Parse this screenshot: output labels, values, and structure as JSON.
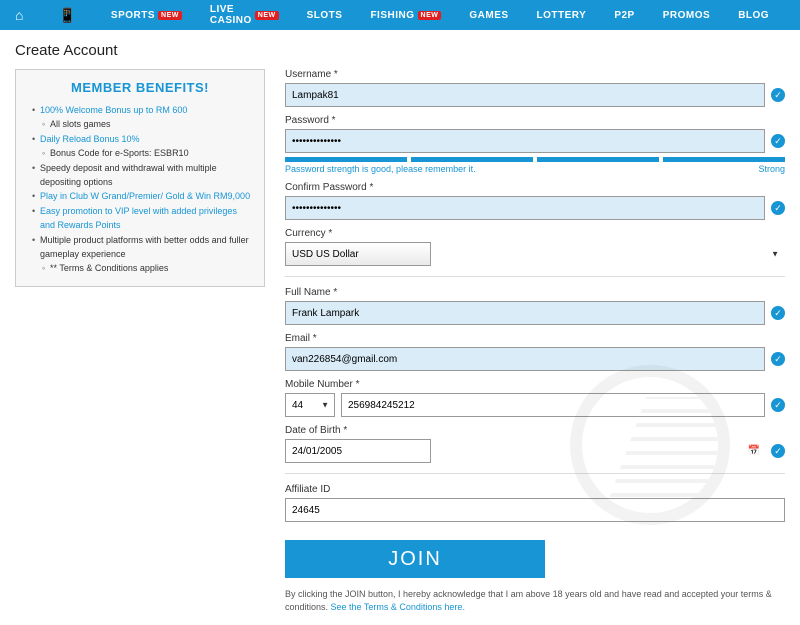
{
  "nav": {
    "items": [
      {
        "label": "SPORTS",
        "new": true
      },
      {
        "label": "LIVE CASINO",
        "new": true
      },
      {
        "label": "SLOTS",
        "new": false
      },
      {
        "label": "FISHING",
        "new": true
      },
      {
        "label": "GAMES",
        "new": false
      },
      {
        "label": "LOTTERY",
        "new": false
      },
      {
        "label": "P2P",
        "new": false
      },
      {
        "label": "PROMOS",
        "new": false
      },
      {
        "label": "BLOG",
        "new": false
      }
    ],
    "new_badge": "NEW"
  },
  "page_title": "Create Account",
  "benefits": {
    "title": "MEMBER BENEFITS!",
    "items": [
      {
        "text": "100% Welcome Bonus up to RM 600",
        "link": true
      },
      {
        "text": "All slots games",
        "sub": true
      },
      {
        "text": "Daily Reload Bonus 10%",
        "link": true
      },
      {
        "text": "Bonus Code for e-Sports: ESBR10",
        "sub": true
      },
      {
        "text": "Speedy deposit and withdrawal with multiple depositing options"
      },
      {
        "text": "Play in Club W Grand/Premier/ Gold & Win RM9,000",
        "link": true
      },
      {
        "text": "Easy promotion to VIP level with added privileges and Rewards Points",
        "link": true
      },
      {
        "text": "Multiple product platforms with better odds and fuller gameplay experience"
      },
      {
        "text": "** Terms & Conditions applies",
        "sub": true
      }
    ]
  },
  "form": {
    "username": {
      "label": "Username *",
      "value": "Lampak81"
    },
    "password": {
      "label": "Password *",
      "value": "••••••••••••••"
    },
    "strength": {
      "msg": "Password strength is good, please remember it.",
      "level": "Strong"
    },
    "confirm": {
      "label": "Confirm Password *",
      "value": "••••••••••••••"
    },
    "currency": {
      "label": "Currency *",
      "value": "USD US Dollar"
    },
    "fullname": {
      "label": "Full Name *",
      "value": "Frank Lampark"
    },
    "email": {
      "label": "Email *",
      "value": "van226854@gmail.com"
    },
    "mobile": {
      "label": "Mobile Number *",
      "code": "44",
      "value": "256984245212"
    },
    "dob": {
      "label": "Date of Birth *",
      "value": "24/01/2005"
    },
    "affiliate": {
      "label": "Affiliate ID",
      "value": "24645"
    },
    "join": "JOIN",
    "disclaimer": "By clicking the JOIN button, I hereby acknowledge that I am above 18 years old and have read and accepted your terms & conditions. ",
    "disclaimer_link": "See the Terms & Conditions here."
  }
}
